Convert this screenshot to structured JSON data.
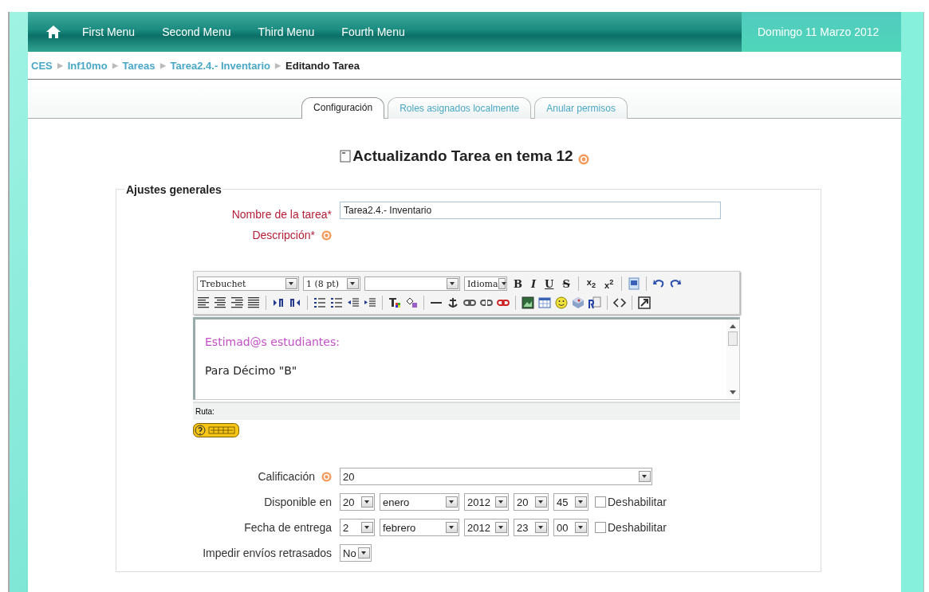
{
  "nav": {
    "items": [
      "First Menu",
      "Second Menu",
      "Third Menu",
      "Fourth Menu"
    ],
    "date": "Domingo 11 Marzo 2012"
  },
  "breadcrumb": [
    {
      "label": "CES",
      "link": true
    },
    {
      "separator": "▶",
      "label": "Inf10mo",
      "link": true
    },
    {
      "separator": "▶",
      "label": "Tareas",
      "link": true
    },
    {
      "separator": "▶",
      "label": "Tarea2.4.- Inventario",
      "link": true
    },
    {
      "separator": "▶",
      "label": "Editando Tarea",
      "link": false
    }
  ],
  "tabs": [
    {
      "label": "Configuración",
      "selected": true
    },
    {
      "label": "Roles asignados localmente",
      "selected": false
    },
    {
      "label": "Anular permisos",
      "selected": false
    }
  ],
  "heading": "Actualizando Tarea en tema 12",
  "section": {
    "legend": "Ajustes generales"
  },
  "name_field": {
    "label": "Nombre de la tarea*",
    "value": "Tarea2.4.- Inventario"
  },
  "description": {
    "label": "Descripción*"
  },
  "editor": {
    "font": "Trebuchet",
    "size": "1 (8 pt)",
    "language": "Idioma",
    "format_buttons": [
      {
        "kind": "bold",
        "text": "B"
      },
      {
        "kind": "italic",
        "text": "I"
      },
      {
        "kind": "underline",
        "text": "U"
      },
      {
        "kind": "strike",
        "text": "S"
      }
    ],
    "script_buttons": [
      "x$_{2}$",
      "x$^{2}$"
    ],
    "content": [
      {
        "kind": "greeting",
        "text": "Estimad@s estudiantes:"
      },
      {
        "kind": "paragraph",
        "text": "Para Décimo \"B\""
      }
    ],
    "path_label": "Ruta:"
  },
  "grade": {
    "label": "Calificación",
    "value": "20"
  },
  "dates": [
    {
      "label": "Disponible en",
      "day": "20",
      "month": "enero",
      "year": "2012",
      "hour": "20",
      "minute": "45",
      "disable_label": "Deshabilitar",
      "checked": false
    },
    {
      "label": "Fecha de entrega",
      "day": "2",
      "month": "febrero",
      "year": "2012",
      "hour": "23",
      "minute": "00",
      "disable_label": "Deshabilitar",
      "checked": false
    }
  ],
  "late": {
    "label": "Impedir envíos retrasados",
    "value": "No"
  }
}
